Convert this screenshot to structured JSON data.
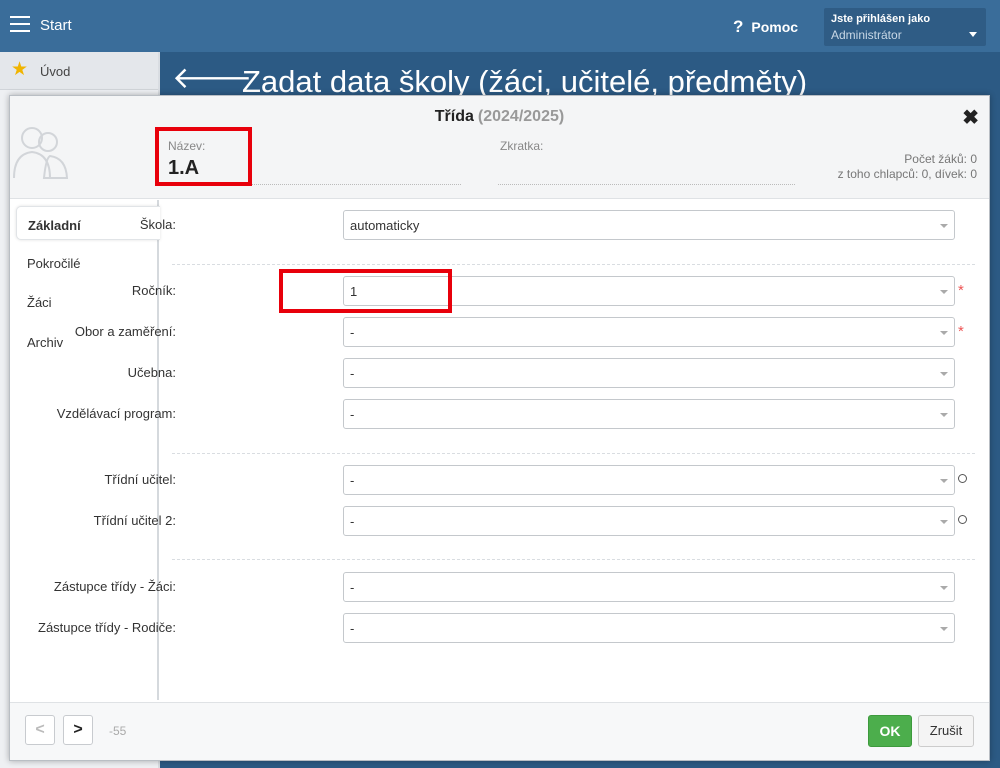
{
  "app": {
    "start_label": "Start",
    "help_label": "Pomoc",
    "help_icon": "?",
    "user_logged_label": "Jste přihlášen jako",
    "user_role": "Administrátor",
    "side_uvod": "Úvod",
    "page_heading": "Zadat data školy (žáci, učitelé, předměty)"
  },
  "modal": {
    "title": "Třída",
    "year": "(2024/2025)",
    "name_label": "Název:",
    "name_value": "1.A",
    "abbr_label": "Zkratka:",
    "student_count": "Počet žáků: 0",
    "gender_count": "z toho chlapců: 0, dívek: 0"
  },
  "tabs": [
    "Základní",
    "Pokročilé",
    "Žáci",
    "Archiv"
  ],
  "form": {
    "skola": {
      "label": "Škola:",
      "value": "automaticky"
    },
    "rocnik": {
      "label": "Ročník:",
      "value": "1"
    },
    "obor": {
      "label": "Obor a zaměření:",
      "value": "-"
    },
    "ucebna": {
      "label": "Učebna:",
      "value": "-"
    },
    "program": {
      "label": "Vzdělávací program:",
      "value": "-"
    },
    "ucitel": {
      "label": "Třídní učitel:",
      "value": "-"
    },
    "ucitel2": {
      "label": "Třídní učitel 2:",
      "value": "-"
    },
    "zastupce_zaci": {
      "label": "Zástupce třídy - Žáci:",
      "value": "-"
    },
    "zastupce_rodice": {
      "label": "Zástupce třídy - Rodiče:",
      "value": "-"
    },
    "required_mark": "*"
  },
  "footer": {
    "prev": "<",
    "next": ">",
    "record_id": "-55",
    "ok": "OK",
    "cancel": "Zrušit"
  },
  "colors": {
    "topbar": "#3a6d9a",
    "content_bg": "#2c5a84",
    "ok_green": "#4cae4c",
    "highlight_red": "#e8000b",
    "star": "#f0b400"
  },
  "icons": [
    "hamburger-icon",
    "help-icon",
    "star-icon",
    "back-arrow-icon",
    "users-icon",
    "close-icon",
    "chevron-down-icon",
    "refresh-icon"
  ]
}
